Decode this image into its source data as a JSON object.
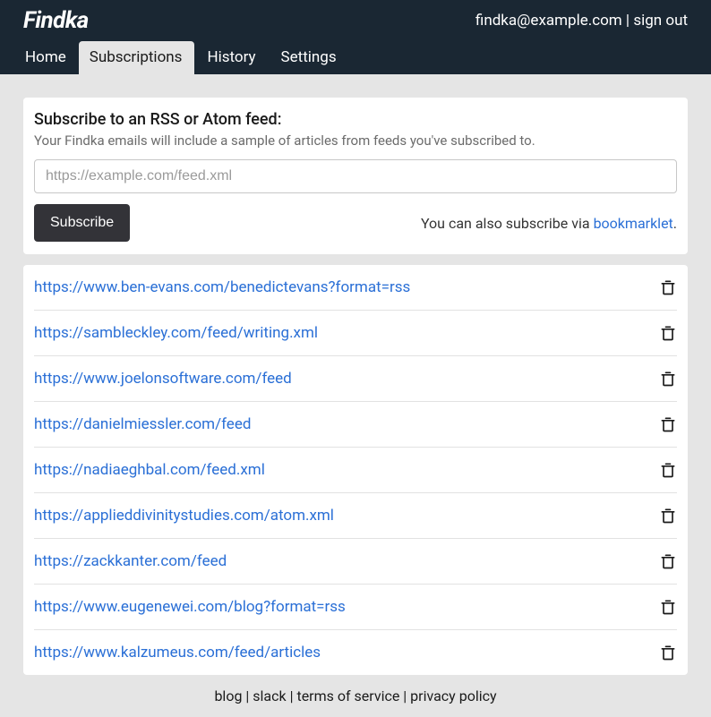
{
  "header": {
    "logo": "Findka",
    "email": "findka@example.com",
    "sep": " | ",
    "signout": "sign out"
  },
  "nav": {
    "items": [
      {
        "label": "Home",
        "active": false
      },
      {
        "label": "Subscriptions",
        "active": true
      },
      {
        "label": "History",
        "active": false
      },
      {
        "label": "Settings",
        "active": false
      }
    ]
  },
  "subscribe_panel": {
    "title": "Subscribe to an RSS or Atom feed:",
    "subtitle": "Your Findka emails will include a sample of articles from feeds you've subscribed to.",
    "placeholder": "https://example.com/feed.xml",
    "button": "Subscribe",
    "hint_prefix": "You can also subscribe via ",
    "hint_link": "bookmarklet",
    "hint_suffix": "."
  },
  "feeds": [
    {
      "url": "https://www.ben-evans.com/benedictevans?format=rss"
    },
    {
      "url": "https://sambleckley.com/feed/writing.xml"
    },
    {
      "url": "https://www.joelonsoftware.com/feed"
    },
    {
      "url": "https://danielmiessler.com/feed"
    },
    {
      "url": "https://nadiaeghbal.com/feed.xml"
    },
    {
      "url": "https://applieddivinitystudies.com/atom.xml"
    },
    {
      "url": "https://zackkanter.com/feed"
    },
    {
      "url": "https://www.eugenewei.com/blog?format=rss"
    },
    {
      "url": "https://www.kalzumeus.com/feed/articles"
    }
  ],
  "footer": {
    "blog": "blog",
    "slack": "slack",
    "tos": "terms of service",
    "privacy": "privacy policy",
    "sep": " | "
  }
}
